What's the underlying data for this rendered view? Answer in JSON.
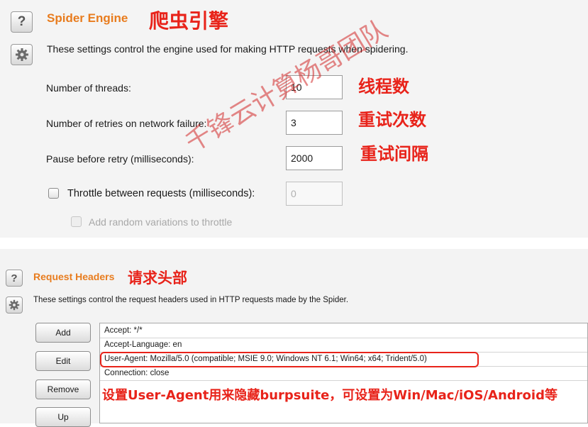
{
  "spider_engine": {
    "title": "Spider Engine",
    "annotation": "爬虫引擎",
    "description": "These settings control the engine used for making HTTP requests when spidering.",
    "threads": {
      "label": "Number of threads:",
      "value": "10",
      "annotation": "线程数"
    },
    "retries": {
      "label": "Number of retries on network failure:",
      "value": "3",
      "annotation": "重试次数"
    },
    "pause": {
      "label": "Pause before retry (milliseconds):",
      "value": "2000",
      "annotation": "重试间隔"
    },
    "throttle": {
      "label": "Throttle between requests (milliseconds):",
      "value": "0",
      "checked": false
    },
    "random_variations": {
      "label": "Add random variations to throttle",
      "checked": false
    }
  },
  "request_headers": {
    "title": "Request Headers",
    "annotation": "请求头部",
    "description": "These settings control the request headers used in HTTP requests made by the Spider.",
    "buttons": [
      "Add",
      "Edit",
      "Remove",
      "Up"
    ],
    "headers": [
      "Accept: */*",
      "Accept-Language: en",
      "User-Agent: Mozilla/5.0 (compatible; MSIE 9.0; Windows NT 6.1; Win64; x64; Trident/5.0)",
      "Connection: close"
    ],
    "note": "设置User-Agent用来隐藏burpsuite，可设置为Win/Mac/iOS/Android等"
  },
  "icons": {
    "help": "help-icon",
    "settings": "gear-icon"
  },
  "colors": {
    "section_title": "#e87c1e",
    "annotation_red": "#e8231a"
  },
  "watermark": "千锋云计算杨哥团队"
}
